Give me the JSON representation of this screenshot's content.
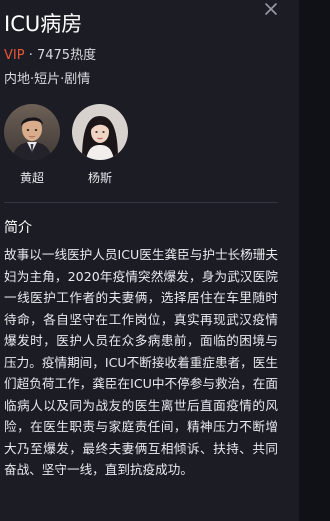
{
  "show": {
    "title": "ICU病房",
    "vip_label": "VIP",
    "separator": " · ",
    "popularity": "7475热度",
    "genre_line": "内地·短片·剧情"
  },
  "cast": [
    {
      "name": "黄超",
      "avatar_icon": "actor-avatar-icon"
    },
    {
      "name": "杨斯",
      "avatar_icon": "actress-avatar-icon"
    }
  ],
  "synopsis": {
    "heading": "简介",
    "text": " 故事以一线医护人员ICU医生龚臣与护士长杨珊夫妇为主角，2020年疫情突然爆发，身为武汉医院一线医护工作者的夫妻俩，选择居住在车里随时待命，各自坚守在工作岗位，真实再现武汉疫情爆发时，医护人员在众多病患前，面临的困境与压力。疫情期间，ICU不断接收着重症患者，医生们超负荷工作，龚臣在ICU中不停参与救治，在面临病人以及同为战友的医生离世后直面疫情的风险，在医生职责与家庭责任间，精神压力不断增大乃至爆发，最终夫妻俩互相倾诉、扶持、共同奋战、坚守一线，直到抗疫成功。"
  },
  "colors": {
    "vip": "#e8553a",
    "panel_bg": "#1c1c25",
    "page_bg": "#13131b"
  },
  "icons": {
    "close": "close-icon"
  }
}
